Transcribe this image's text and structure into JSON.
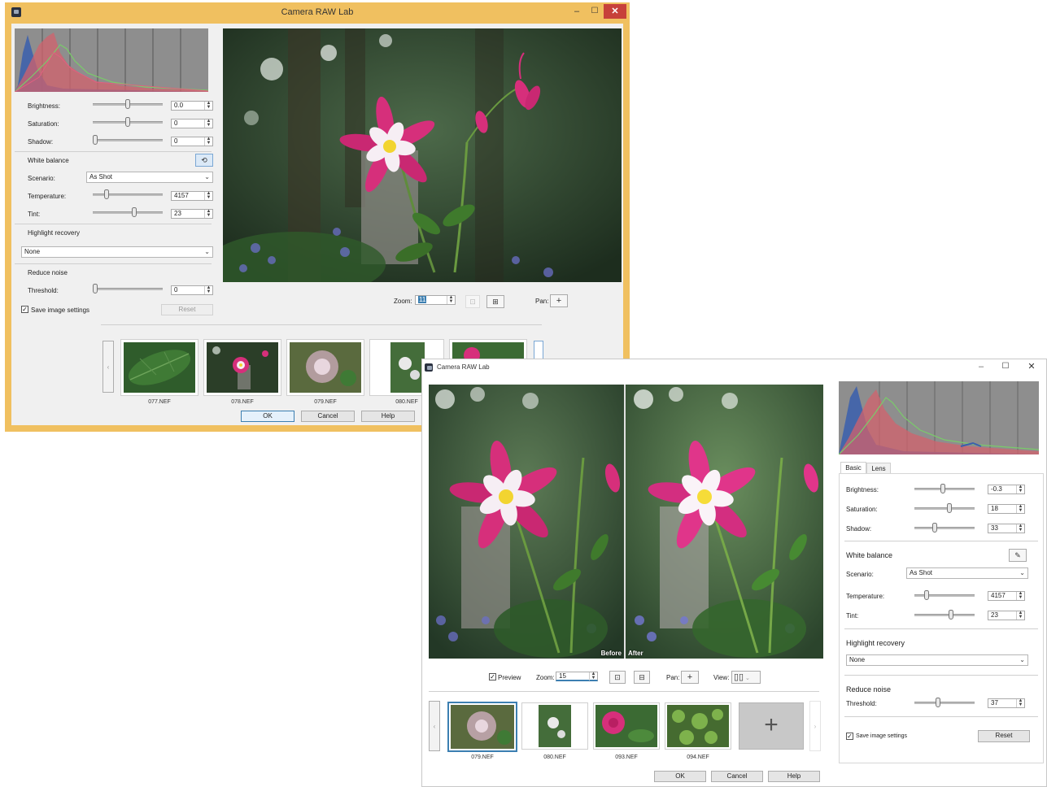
{
  "window1": {
    "title": "Camera RAW Lab",
    "controls": {
      "minimize": "–",
      "maximize": "☐",
      "close": "✕"
    },
    "brightness": {
      "label": "Brightness:",
      "value": "0.0",
      "pos": 0.5
    },
    "saturation": {
      "label": "Saturation:",
      "value": "0",
      "pos": 0.5
    },
    "shadow": {
      "label": "Shadow:",
      "value": "0",
      "pos": 0.0
    },
    "white_balance": {
      "label": "White balance"
    },
    "scenario": {
      "label": "Scenario:",
      "value": "As Shot"
    },
    "temperature": {
      "label": "Temperature:",
      "value": "4157",
      "pos": 0.2
    },
    "tint": {
      "label": "Tint:",
      "value": "23",
      "pos": 0.6
    },
    "highlight_recovery": {
      "label": "Highlight recovery",
      "value": "None"
    },
    "reduce_noise": {
      "label": "Reduce noise"
    },
    "threshold": {
      "label": "Threshold:",
      "value": "0",
      "pos": 0.0
    },
    "save_settings": {
      "label": "Save image settings",
      "checked": true
    },
    "reset_label": "Reset",
    "zoom": {
      "label": "Zoom:",
      "value": "11"
    },
    "pan_label": "Pan:",
    "thumbnails": [
      {
        "name": "077.NEF",
        "kind": "leaf"
      },
      {
        "name": "078.NEF",
        "kind": "flower"
      },
      {
        "name": "079.NEF",
        "kind": "fuzzy"
      },
      {
        "name": "080.NEF",
        "kind": "portrait"
      },
      {
        "name": "",
        "kind": "rose"
      }
    ],
    "ok_label": "OK",
    "cancel_label": "Cancel",
    "help_label": "Help"
  },
  "window2": {
    "title": "Camera RAW Lab",
    "controls": {
      "minimize": "–",
      "maximize": "☐",
      "close": "✕"
    },
    "tabs": [
      {
        "label": "Basic",
        "active": true
      },
      {
        "label": "Lens",
        "active": false
      }
    ],
    "brightness": {
      "label": "Brightness:",
      "value": "-0.3",
      "pos": 0.45
    },
    "saturation": {
      "label": "Saturation:",
      "value": "18",
      "pos": 0.58
    },
    "shadow": {
      "label": "Shadow:",
      "value": "33",
      "pos": 0.33
    },
    "white_balance": {
      "label": "White balance"
    },
    "scenario": {
      "label": "Scenario:",
      "value": "As Shot"
    },
    "temperature": {
      "label": "Temperature:",
      "value": "4157",
      "pos": 0.2
    },
    "tint": {
      "label": "Tint:",
      "value": "23",
      "pos": 0.6
    },
    "highlight_recovery": {
      "label": "Highlight recovery",
      "value": "None"
    },
    "reduce_noise": {
      "label": "Reduce noise"
    },
    "threshold": {
      "label": "Threshold:",
      "value": "37",
      "pos": 0.37
    },
    "save_settings": {
      "label": "Save image settings",
      "checked": true
    },
    "reset_label": "Reset",
    "before_label": "Before",
    "after_label": "After",
    "preview": {
      "label": "Preview",
      "checked": true
    },
    "zoom": {
      "label": "Zoom:",
      "value": "15"
    },
    "pan_label": "Pan:",
    "view_label": "View:",
    "thumbnails": [
      {
        "name": "079.NEF",
        "kind": "fuzzy",
        "selected": true
      },
      {
        "name": "080.NEF",
        "kind": "portrait"
      },
      {
        "name": "093.NEF",
        "kind": "rose"
      },
      {
        "name": "094.NEF",
        "kind": "green"
      }
    ],
    "ok_label": "OK",
    "cancel_label": "Cancel",
    "help_label": "Help"
  },
  "colors": {
    "window1_frame": "#f0c060",
    "accent": "#3c7fb1",
    "close": "#c7413a",
    "flower_pink": "#d62f7b"
  }
}
